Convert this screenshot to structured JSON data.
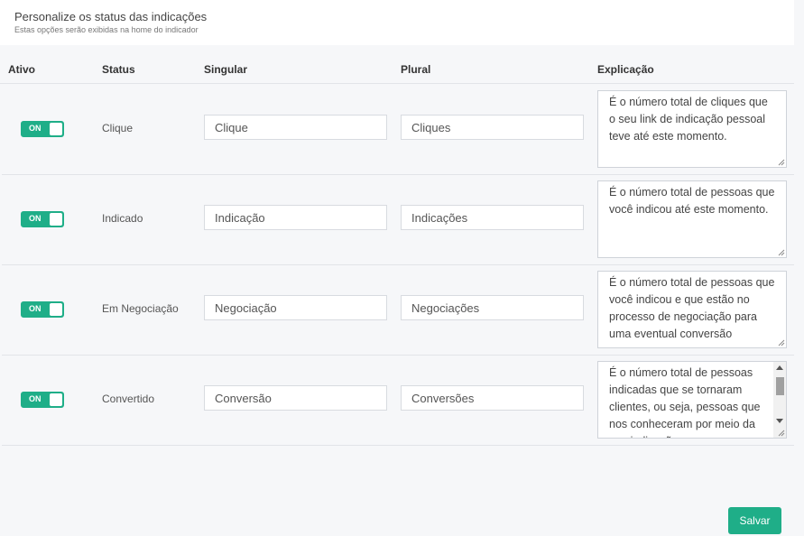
{
  "header": {
    "title": "Personalize os status das indicações",
    "subtitle": "Estas opções serão exibidas na home do indicador"
  },
  "table": {
    "columns": [
      "Ativo",
      "Status",
      "Singular",
      "Plural",
      "Explicação"
    ],
    "rows": [
      {
        "toggle": "ON",
        "status": "Clique",
        "singular": "Clique",
        "plural": "Cliques",
        "explanation": "É o número total de cliques que o seu link de indicação pessoal teve até este momento."
      },
      {
        "toggle": "ON",
        "status": "Indicado",
        "singular": "Indicação",
        "plural": "Indicações",
        "explanation": "É o número total de pessoas que você indicou até este momento."
      },
      {
        "toggle": "ON",
        "status": "Em Negociação",
        "singular": "Negociação",
        "plural": "Negociações",
        "explanation": "É o número total de pessoas que você indicou e que estão no processo de negociação para uma eventual conversão"
      },
      {
        "toggle": "ON",
        "status": "Convertido",
        "singular": "Conversão",
        "plural": "Conversões",
        "explanation": "É o número total de pessoas indicadas que se tornaram clientes, ou seja, pessoas que nos conheceram por meio da sua indicação"
      }
    ]
  },
  "actions": {
    "save_label": "Salvar"
  },
  "colors": {
    "accent": "#1fae88",
    "background": "#f6f7f9",
    "border": "#e2e4e8"
  }
}
